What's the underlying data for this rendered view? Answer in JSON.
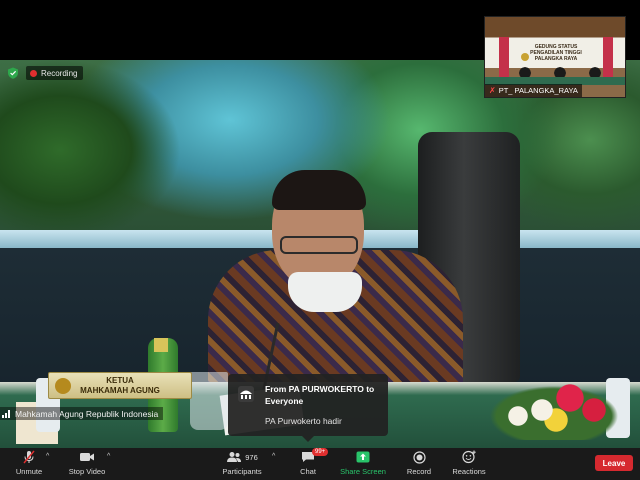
{
  "indicators": {
    "recording_label": "Recording"
  },
  "main_video": {
    "nameplate_line1": "KETUA",
    "nameplate_line2": "MAHKAMAH AGUNG",
    "speaker_name": "Mahkamah Agung Republik Indonesia"
  },
  "thumbnail": {
    "participant_name": "PT_ PALANGKA_RAYA",
    "banner_line1": "GEDUNG STATUS",
    "banner_line2": "PENGADILAN TINGGI",
    "banner_line3": "PALANGKA RAYA"
  },
  "chat_notification": {
    "from": "From PA PURWOKERTO to Everyone",
    "message": "PA Purwokerto hadir"
  },
  "toolbar": {
    "unmute_label": "Unmute",
    "stop_video_label": "Stop Video",
    "participants_label": "Participants",
    "participants_count": "976",
    "chat_label": "Chat",
    "chat_badge": "99+",
    "share_screen_label": "Share Screen",
    "record_label": "Record",
    "reactions_label": "Reactions",
    "leave_label": "Leave"
  },
  "colors": {
    "toolbar_bg": "#1a1a1a",
    "share_green": "#29c46a",
    "leave_red": "#d6292f",
    "recording_red": "#e02f2f"
  }
}
